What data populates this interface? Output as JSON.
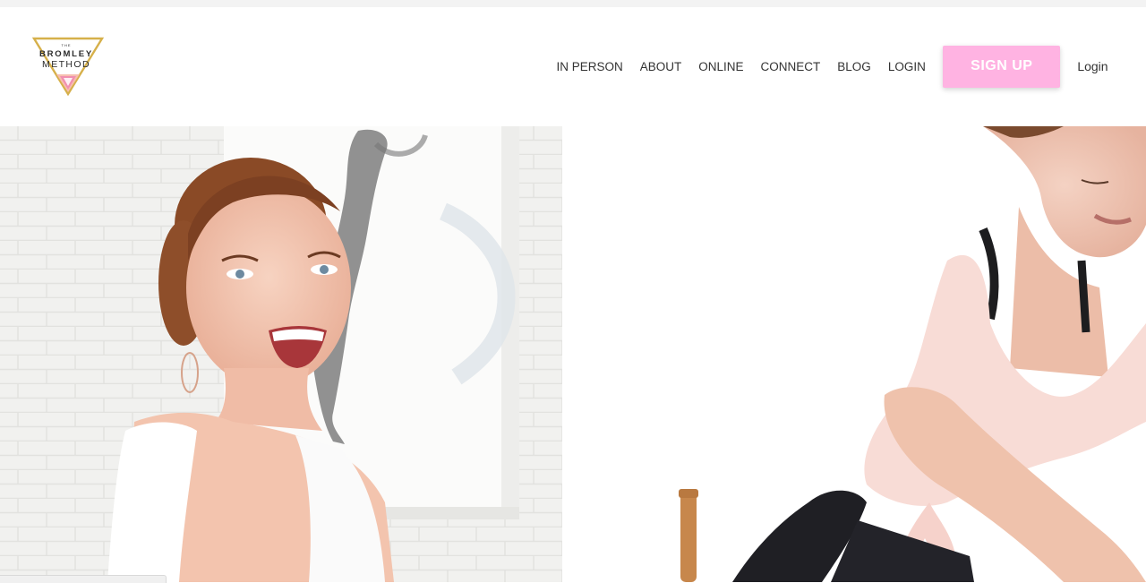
{
  "logo": {
    "the": "THE",
    "line1": "BROMLEY",
    "line2": "METHOD"
  },
  "nav": {
    "items": [
      "IN PERSON",
      "ABOUT",
      "ONLINE",
      "CONNECT",
      "BLOG",
      "LOGIN"
    ],
    "signup_label": "SIGN UP",
    "login_label": "Login"
  },
  "hero": {
    "left_image": "smiling-woman-photo",
    "right_image": "woman-exercising-photo"
  },
  "colors": {
    "accent_pink": "#ffb3e2",
    "logo_gold": "#d6b04a",
    "logo_pink": "#f08ab0",
    "text": "#333333"
  }
}
